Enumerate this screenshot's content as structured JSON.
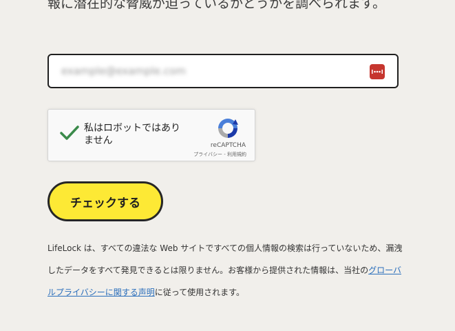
{
  "intro": {
    "text": "報に潜在的な脅威が迫っているかどうかを調べられます。"
  },
  "email": {
    "value": "example@example.com",
    "password_icon": "dots-icon",
    "password_icon_color": "#c6362f"
  },
  "recaptcha": {
    "checkbox_label": "私はロボットではありません",
    "brand": "reCAPTCHA",
    "privacy_link": "プライバシー",
    "separator": " - ",
    "terms_link": "利用規約",
    "check_color": "#3a8a4a"
  },
  "check_button": {
    "label": "チェックする",
    "color": "#fde935"
  },
  "disclaimer": {
    "text_before": "LifeLock は、すべての違法な Web サイトですべての個人情報の検索は行っていないため、漏洩したデータをすべて発見できるとは限りません。お客様から提供された情報は、当社の",
    "link_text": "グローバルプライバシーに関する声明",
    "text_after": "に従って使用されます。",
    "link_color": "#2a6ebb"
  }
}
